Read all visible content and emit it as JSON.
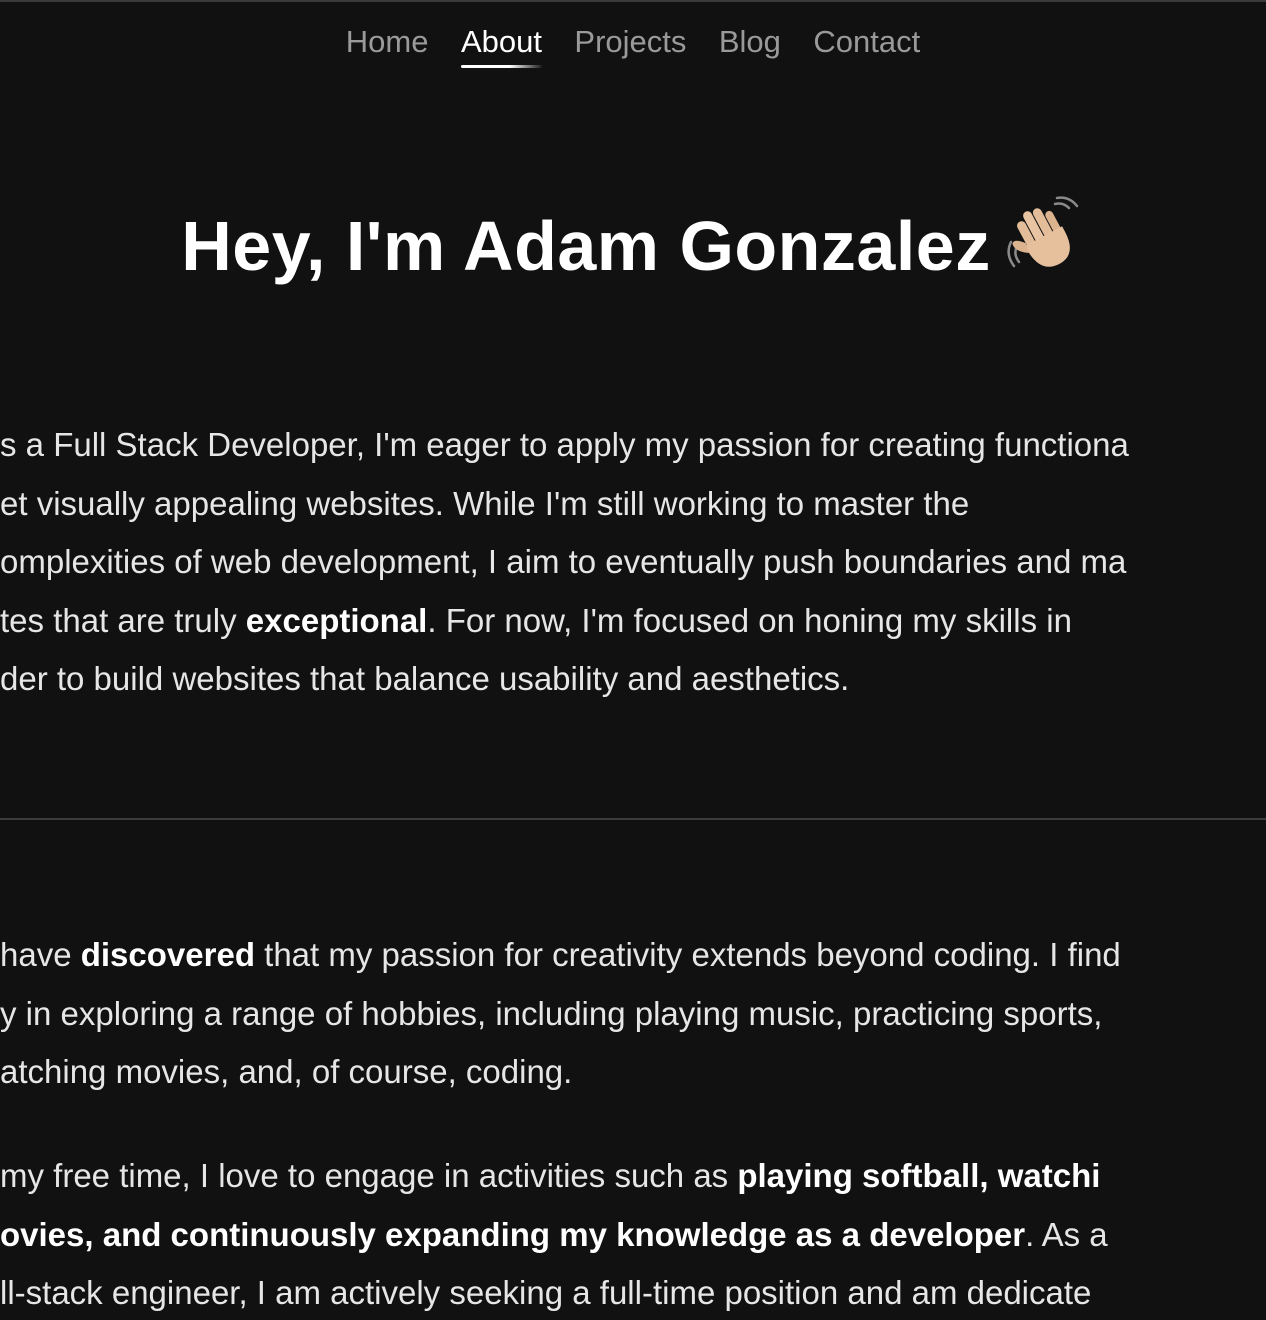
{
  "nav": {
    "items": [
      {
        "label": "Home"
      },
      {
        "label": "About"
      },
      {
        "label": "Projects"
      },
      {
        "label": "Blog"
      },
      {
        "label": "Contact"
      }
    ],
    "active": "About"
  },
  "hero": {
    "title": "Hey, I'm Adam Gonzalez",
    "emoji_icon": "waving-hand-icon"
  },
  "intro": {
    "lines": [
      {
        "a": "s a Full Stack Developer, I'm eager to apply my passion for creating functiona"
      },
      {
        "a": "et visually appealing websites. While I'm still working to master the"
      },
      {
        "a": "omplexities of web development, I aim to eventually push boundaries and ma"
      },
      {
        "a": "tes that are truly ",
        "b": "exceptional",
        "c": ". For now, I'm focused on honing my skills in"
      },
      {
        "a": "der to build websites that balance usability and aesthetics."
      }
    ]
  },
  "hobbies": {
    "lines": [
      {
        "a": "have ",
        "b": "discovered",
        "c": " that my passion for creativity extends beyond coding. I find"
      },
      {
        "a": "y in exploring a range of hobbies, including playing music, practicing sports,"
      },
      {
        "a": "atching movies, and, of course, coding."
      }
    ]
  },
  "free_time": {
    "lines": [
      {
        "a": " my free time, I love to engage in activities such as ",
        "b": "playing softball, watchi"
      },
      {
        "b": "ovies, and continuously expanding my knowledge as a developer",
        "c": ". As a"
      },
      {
        "a": "ll-stack engineer, I am actively seeking a full-time position and am dedicate"
      }
    ]
  },
  "colors": {
    "background": "#111111",
    "text": "#e6e6e6",
    "nav_inactive": "#9a9a9a",
    "nav_active": "#ffffff",
    "divider": "#3c3c3c"
  }
}
